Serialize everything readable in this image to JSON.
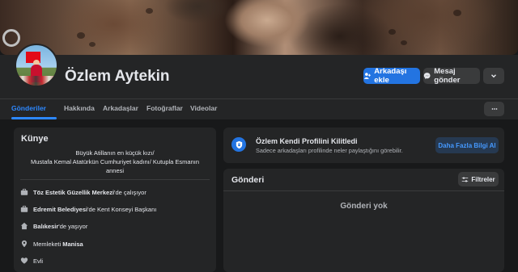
{
  "profile": {
    "name": "Özlem Aytekin"
  },
  "actions": {
    "add_friend": "Arkadaşı ekle",
    "send_message": "Mesaj gönder"
  },
  "tabs": [
    {
      "label": "Gönderiler",
      "active": true
    },
    {
      "label": "Hakkında"
    },
    {
      "label": "Arkadaşlar"
    },
    {
      "label": "Fotoğraflar"
    },
    {
      "label": "Videolar"
    }
  ],
  "intro": {
    "title": "Künye",
    "bio_lines": [
      "Büyük Atillanın en küçük kızı/",
      "Mustafa Kemal Atatürkün Cumhuriyet kadını/ Kutupla Esmanın",
      "annesi"
    ],
    "items": [
      {
        "icon": "briefcase-icon",
        "bold": "Töz Estetik Güzellik Merkezi",
        "rest": "'de çalışıyor"
      },
      {
        "icon": "briefcase-icon",
        "bold": "Edremit Belediyesi",
        "rest": "'de Kent Konseyi Başkanı"
      },
      {
        "icon": "home-icon",
        "bold": "Balıkesir",
        "rest": "'de yaşıyor"
      },
      {
        "icon": "location-pin-icon",
        "pre": "Memleketi ",
        "bold": "Manisa"
      },
      {
        "icon": "heart-icon",
        "pre": "Evli"
      }
    ]
  },
  "locked": {
    "title": "Özlem Kendi Profilini Kilitledi",
    "subtitle": "Sadece arkadaşları profilinde neler paylaştığını görebilir.",
    "button": "Daha Fazla Bilgi Al"
  },
  "posts": {
    "title": "Gönderi",
    "filter": "Filtreler",
    "empty": "Gönderi yok"
  },
  "colors": {
    "accent": "#2374e1",
    "link": "#2d88ff",
    "background": "#18191a",
    "card": "#242526"
  }
}
